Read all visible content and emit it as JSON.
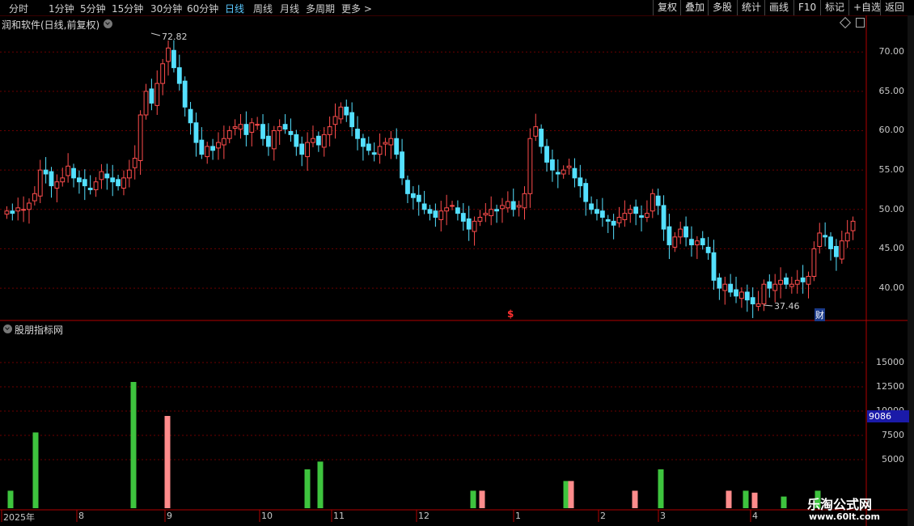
{
  "toolbar": {
    "periods": [
      "分时",
      "1分钟",
      "5分钟",
      "15分钟",
      "30分钟",
      "60分钟",
      "日线",
      "周线",
      "月线",
      "多周期",
      "更多 >"
    ],
    "active_period": "日线",
    "buttons": [
      "复权",
      "叠加",
      "多股",
      "统计",
      "画线",
      "F10",
      "标记",
      "+自选",
      "返回"
    ]
  },
  "main_chart": {
    "title": "润和软件(日线,前复权)",
    "high_label": "72.82",
    "low_label": "37.46",
    "fin_badge": "财",
    "dollar_marker": "$",
    "y_ticks": [
      "70.00",
      "65.00",
      "60.00",
      "55.00",
      "50.00",
      "45.00",
      "40.00"
    ]
  },
  "sub_chart": {
    "title": "股朋指标网",
    "y_ticks": [
      "15000",
      "12500",
      "10000",
      "7500",
      "5000"
    ],
    "cursor_value": "9086"
  },
  "x_axis": {
    "labels": [
      "2025年",
      "8",
      "9",
      "10",
      "11",
      "12",
      "1",
      "2",
      "3",
      "4"
    ]
  },
  "watermark": {
    "line1": "乐淘公式网",
    "line2": "www.60lt.com"
  },
  "colors": {
    "up": "#ff4d4d",
    "down": "#54e0ff",
    "green_bar": "#3ec43e",
    "pink_bar": "#ff8c8c",
    "grid": "#6b0000",
    "border": "#b00000"
  },
  "chart_data": [
    {
      "type": "candlestick",
      "title": "润和软件(日线,前复权)",
      "ylim": [
        36,
        73
      ],
      "y_ticks": [
        70,
        65,
        60,
        55,
        50,
        45,
        40
      ],
      "close": [
        49.8,
        49.5,
        50.2,
        50.0,
        50.8,
        52.0,
        55.0,
        54.5,
        53.0,
        53.5,
        54.0,
        55.5,
        54.0,
        53.5,
        53.0,
        52.5,
        53.5,
        54.8,
        54.0,
        53.5,
        53.0,
        54.0,
        55.0,
        56.5,
        62.0,
        65.0,
        63.5,
        66.0,
        68.5,
        70.5,
        68.0,
        66.0,
        63.0,
        61.0,
        58.5,
        57.0,
        58.0,
        57.5,
        58.5,
        59.0,
        60.0,
        60.5,
        60.8,
        59.5,
        61.0,
        60.8,
        59.0,
        58.0,
        60.0,
        60.5,
        60.2,
        59.5,
        58.0,
        57.0,
        58.5,
        59.0,
        58.2,
        59.5,
        60.5,
        61.8,
        63.0,
        62.0,
        60.5,
        59.0,
        58.0,
        57.5,
        57.0,
        58.0,
        58.5,
        59.0,
        57.0,
        54.0,
        52.0,
        51.5,
        51.0,
        50.0,
        49.5,
        49.0,
        49.8,
        50.2,
        50.5,
        49.5,
        48.5,
        47.5,
        48.5,
        49.0,
        49.5,
        50.0,
        49.8,
        50.5,
        51.0,
        50.0,
        50.5,
        52.0,
        59.0,
        60.5,
        58.0,
        56.0,
        55.0,
        54.5,
        55.0,
        55.5,
        54.0,
        53.0,
        51.0,
        50.0,
        49.5,
        49.0,
        48.5,
        48.0,
        49.0,
        49.5,
        50.0,
        49.5,
        49.0,
        49.5,
        52.0,
        50.5,
        47.5,
        45.5,
        46.5,
        47.5,
        46.5,
        45.5,
        46.0,
        45.5,
        44.5,
        41.0,
        40.0,
        40.5,
        39.5,
        39.0,
        39.5,
        38.5,
        38.0,
        38.0,
        40.5,
        40.0,
        40.5,
        41.0,
        40.5,
        40.5,
        41.0,
        40.8,
        41.5,
        45.0,
        47.0,
        46.5,
        45.0,
        44.0,
        46.0,
        47.0,
        48.5
      ]
    },
    {
      "type": "bar",
      "title": "股朋指标网",
      "ylim": [
        0,
        17500
      ],
      "y_ticks": [
        15000,
        12500,
        10000,
        7500,
        5000
      ],
      "series": [
        {
          "color_key": "green_bar",
          "values": [
            1800,
            7800,
            13000,
            4000,
            4800,
            1800,
            2800,
            4000,
            1800,
            1200,
            1800,
            1200
          ]
        },
        {
          "color_key": "pink_bar",
          "values": [
            9500,
            1800,
            2800,
            1800,
            1800,
            1600
          ]
        }
      ]
    }
  ]
}
